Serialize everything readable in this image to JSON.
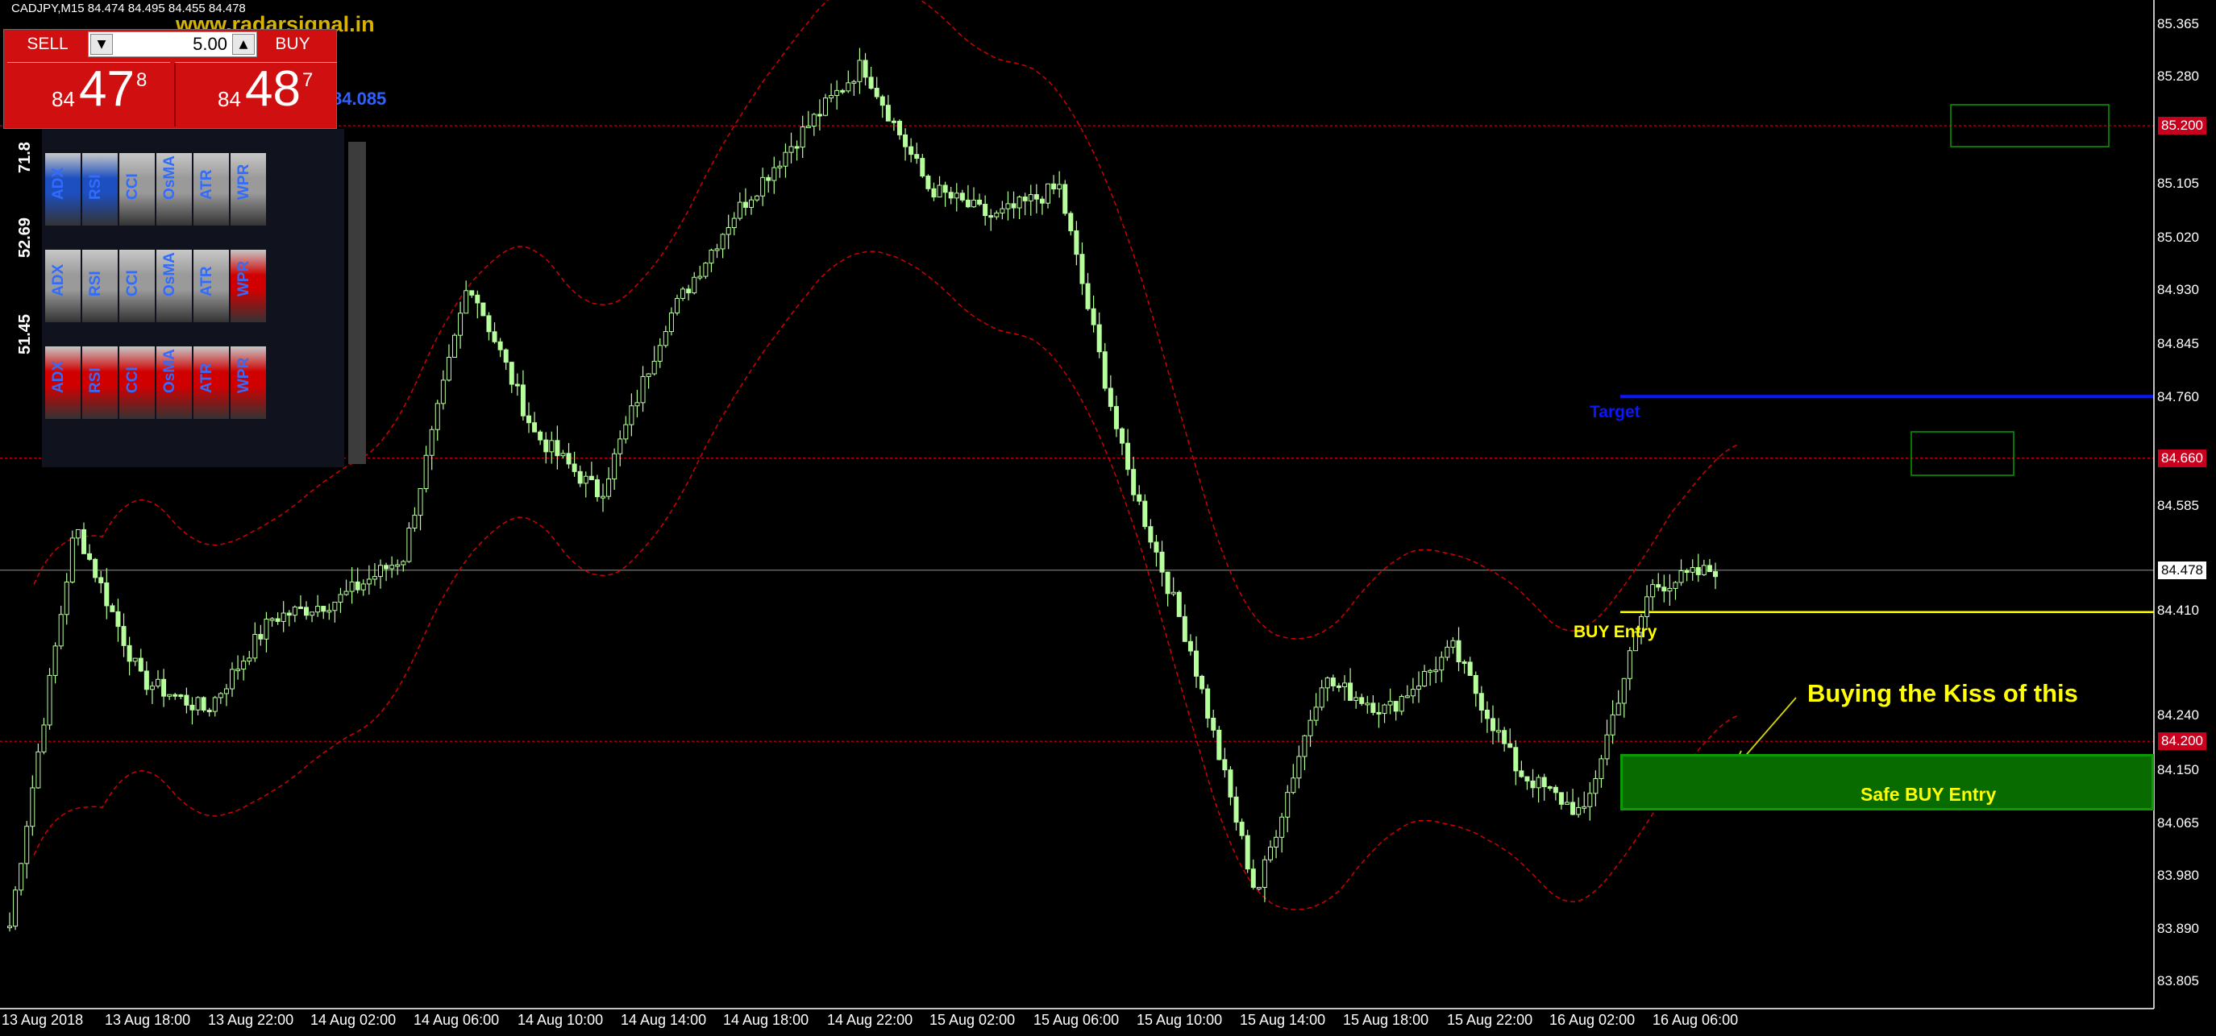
{
  "header": {
    "symbol_line": "CADJPY,M15  84.474 84.495 84.455 84.478",
    "watermark": "www.radarsignal.in",
    "blue_price": "84.085"
  },
  "trade_panel": {
    "sell_label": "SELL",
    "buy_label": "BUY",
    "lot_value": "5.00",
    "sell_quote": {
      "prefix": "84",
      "big": "47",
      "sup": "8"
    },
    "buy_quote": {
      "prefix": "84",
      "big": "48",
      "sup": "7"
    }
  },
  "indicator_matrix": {
    "labels": [
      "ADX",
      "RSI",
      "CCI",
      "OsMA",
      "ATR",
      "WPR"
    ],
    "row_values": [
      "71.8",
      "52.69",
      "51.45"
    ]
  },
  "price_axis": {
    "ticks": [
      "85.365",
      "85.280",
      "85.105",
      "85.020",
      "84.930",
      "84.845",
      "84.760",
      "84.585",
      "84.410",
      "84.240",
      "84.150",
      "84.065",
      "83.980",
      "83.890",
      "83.805"
    ],
    "badges": [
      {
        "value": "85.200",
        "style": "red"
      },
      {
        "value": "84.660",
        "style": "red"
      },
      {
        "value": "84.478",
        "style": "white"
      },
      {
        "value": "84.200",
        "style": "red"
      }
    ]
  },
  "time_axis": [
    "13 Aug 2018",
    "13 Aug 18:00",
    "13 Aug 22:00",
    "14 Aug 02:00",
    "14 Aug 06:00",
    "14 Aug 10:00",
    "14 Aug 14:00",
    "14 Aug 18:00",
    "14 Aug 22:00",
    "15 Aug 02:00",
    "15 Aug 06:00",
    "15 Aug 10:00",
    "15 Aug 14:00",
    "15 Aug 18:00",
    "15 Aug 22:00",
    "16 Aug 02:00",
    "16 Aug 06:00"
  ],
  "annotations": {
    "target": "Target",
    "buy_entry": "BUY Entry",
    "kiss": "Buying the Kiss of this",
    "safe_buy": "Safe BUY Entry"
  },
  "colors": {
    "candles": "#b7ff9c",
    "envelope": "#d00000",
    "target_line": "#0a16ff",
    "entry_line": "#ffff00",
    "safe_zone": "#076b00"
  },
  "chart_data": {
    "type": "candlestick",
    "symbol": "CADJPY",
    "timeframe": "M15",
    "ohlc_last": {
      "open": 84.474,
      "high": 84.495,
      "low": 84.455,
      "close": 84.478
    },
    "ylim": [
      83.805,
      85.365
    ],
    "x": [
      "13 Aug 2018",
      "13 Aug 18:00",
      "13 Aug 22:00",
      "14 Aug 02:00",
      "14 Aug 06:00",
      "14 Aug 10:00",
      "14 Aug 14:00",
      "14 Aug 18:00",
      "14 Aug 22:00",
      "15 Aug 02:00",
      "15 Aug 06:00",
      "15 Aug 10:00",
      "15 Aug 14:00",
      "15 Aug 18:00",
      "15 Aug 22:00",
      "16 Aug 02:00",
      "16 Aug 06:00"
    ],
    "close_path": [
      83.9,
      84.55,
      84.3,
      84.25,
      84.4,
      84.43,
      84.5,
      84.95,
      84.7,
      84.6,
      84.88,
      85.05,
      85.18,
      85.3,
      85.1,
      85.05,
      85.1,
      84.65,
      84.35,
      83.95,
      84.3,
      84.25,
      84.35,
      84.15,
      84.08,
      84.45,
      84.48
    ],
    "levels": {
      "target": 84.76,
      "buy_entry": 84.41,
      "safe_zone": [
        84.095,
        84.17
      ],
      "resistance_lines": [
        85.2,
        84.66,
        84.2
      ],
      "current": 84.478
    },
    "grid": false
  }
}
